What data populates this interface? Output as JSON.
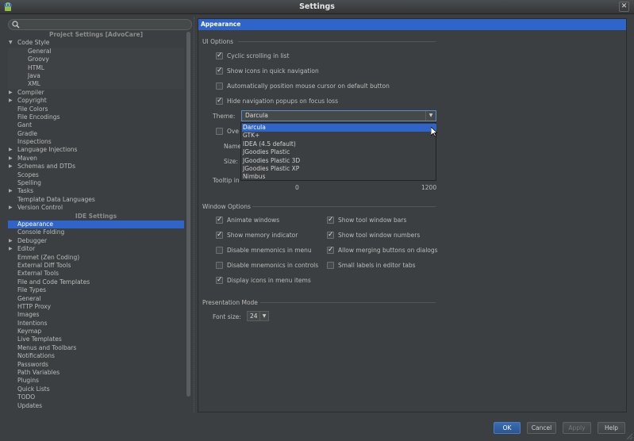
{
  "window": {
    "title": "Settings",
    "close_glyph": "✕"
  },
  "left": {
    "search_placeholder": "",
    "project_section": "Project Settings [AdvoCare]",
    "ide_section": "IDE Settings",
    "project_items": [
      {
        "label": "Code Style",
        "arrow": "▼"
      },
      {
        "label": "General",
        "child": true
      },
      {
        "label": "Groovy",
        "child": true
      },
      {
        "label": "HTML",
        "child": true
      },
      {
        "label": "Java",
        "child": true
      },
      {
        "label": "XML",
        "child": true
      },
      {
        "label": "Compiler",
        "arrow": "▶"
      },
      {
        "label": "Copyright",
        "arrow": "▶"
      },
      {
        "label": "File Colors"
      },
      {
        "label": "File Encodings"
      },
      {
        "label": "Gant"
      },
      {
        "label": "Gradle"
      },
      {
        "label": "Inspections"
      },
      {
        "label": "Language Injections",
        "arrow": "▶"
      },
      {
        "label": "Maven",
        "arrow": "▶"
      },
      {
        "label": "Schemas and DTDs",
        "arrow": "▶"
      },
      {
        "label": "Scopes"
      },
      {
        "label": "Spelling"
      },
      {
        "label": "Tasks",
        "arrow": "▶"
      },
      {
        "label": "Template Data Languages"
      },
      {
        "label": "Version Control",
        "arrow": "▶"
      }
    ],
    "ide_items": [
      {
        "label": "Appearance",
        "selected": true
      },
      {
        "label": "Console Folding"
      },
      {
        "label": "Debugger",
        "arrow": "▶"
      },
      {
        "label": "Editor",
        "arrow": "▶"
      },
      {
        "label": "Emmet (Zen Coding)"
      },
      {
        "label": "External Diff Tools"
      },
      {
        "label": "External Tools"
      },
      {
        "label": "File and Code Templates"
      },
      {
        "label": "File Types"
      },
      {
        "label": "General"
      },
      {
        "label": "HTTP Proxy"
      },
      {
        "label": "Images"
      },
      {
        "label": "Intentions"
      },
      {
        "label": "Keymap"
      },
      {
        "label": "Live Templates"
      },
      {
        "label": "Menus and Toolbars"
      },
      {
        "label": "Notifications"
      },
      {
        "label": "Passwords"
      },
      {
        "label": "Path Variables"
      },
      {
        "label": "Plugins"
      },
      {
        "label": "Quick Lists"
      },
      {
        "label": "TODO"
      },
      {
        "label": "Updates"
      }
    ]
  },
  "right": {
    "header": "Appearance",
    "ui_options": {
      "title": "UI Options",
      "cyclic_scrolling": {
        "label": "Cyclic scrolling in list",
        "checked": true
      },
      "show_icons": {
        "label": "Show icons in quick navigation",
        "checked": true
      },
      "auto_mouse": {
        "label": "Automatically position mouse cursor on default button",
        "checked": false
      },
      "hide_nav": {
        "label": "Hide navigation popups on focus loss",
        "checked": true
      },
      "theme_label": "Theme:",
      "theme_value": "Darcula",
      "theme_options": [
        "Darcula",
        "GTK+",
        "IDEA (4.5 default)",
        "JGoodies Plastic",
        "JGoodies Plastic 3D",
        "JGoodies Plastic XP",
        "Nimbus"
      ],
      "override_label": "Ove",
      "name_label": "Name",
      "size_label": "Size:",
      "tooltip_label": "Tooltip initial delay (ms):",
      "tooltip_visible": "Tooltip in",
      "tooltip_min": "0",
      "tooltip_max": "1200"
    },
    "window_options": {
      "title": "Window Options",
      "animate": {
        "label": "Animate windows",
        "checked": true
      },
      "memory": {
        "label": "Show memory indicator",
        "checked": true
      },
      "mnemonics_menu": {
        "label": "Disable mnemonics in menu",
        "checked": false
      },
      "mnemonics_controls": {
        "label": "Disable mnemonics in controls",
        "checked": false
      },
      "display_icons": {
        "label": "Display icons in menu items",
        "checked": true
      },
      "tool_bars": {
        "label": "Show tool window bars",
        "checked": true
      },
      "tool_numbers": {
        "label": "Show tool window numbers",
        "checked": true
      },
      "merging": {
        "label": "Allow merging buttons on dialogs",
        "checked": true
      },
      "small_labels": {
        "label": "Small labels in editor tabs",
        "checked": false
      }
    },
    "presentation": {
      "title": "Presentation Mode",
      "font_size_label": "Font size:",
      "font_size_value": "24"
    }
  },
  "buttons": {
    "ok": "OK",
    "cancel": "Cancel",
    "apply": "Apply",
    "help": "Help"
  },
  "colors": {
    "selection": "#2f65ca",
    "background": "#3c3f41"
  }
}
